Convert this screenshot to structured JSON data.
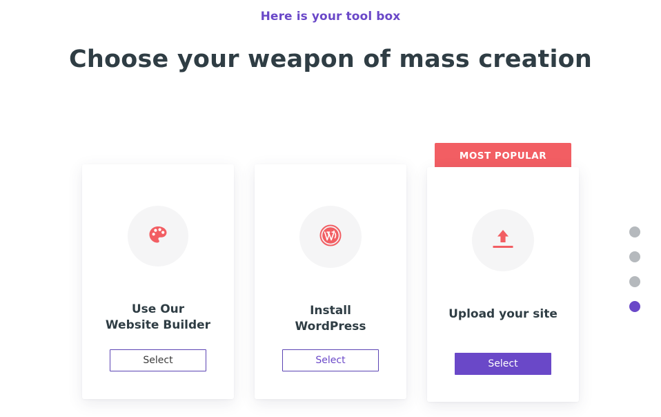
{
  "header": {
    "eyebrow": "Here is your tool box",
    "title": "Choose your weapon of mass creation"
  },
  "badge": {
    "label": "MOST POPULAR",
    "color": "#f25e63"
  },
  "cards": [
    {
      "icon": "palette-icon",
      "title_line1": "Use Our",
      "title_line2": "Website Builder",
      "button_label": "Select"
    },
    {
      "icon": "wordpress-icon",
      "title_line1": "Install",
      "title_line2": "WordPress",
      "button_label": "Select"
    },
    {
      "icon": "upload-icon",
      "title_line1": "Upload your site",
      "button_label": "Select"
    }
  ],
  "pagination": {
    "count": 4,
    "active_index": 3
  },
  "colors": {
    "accent": "#6a48c8",
    "icon": "#f25e63",
    "heading": "#2f3d44",
    "dot_inactive": "#b5b9bd"
  }
}
